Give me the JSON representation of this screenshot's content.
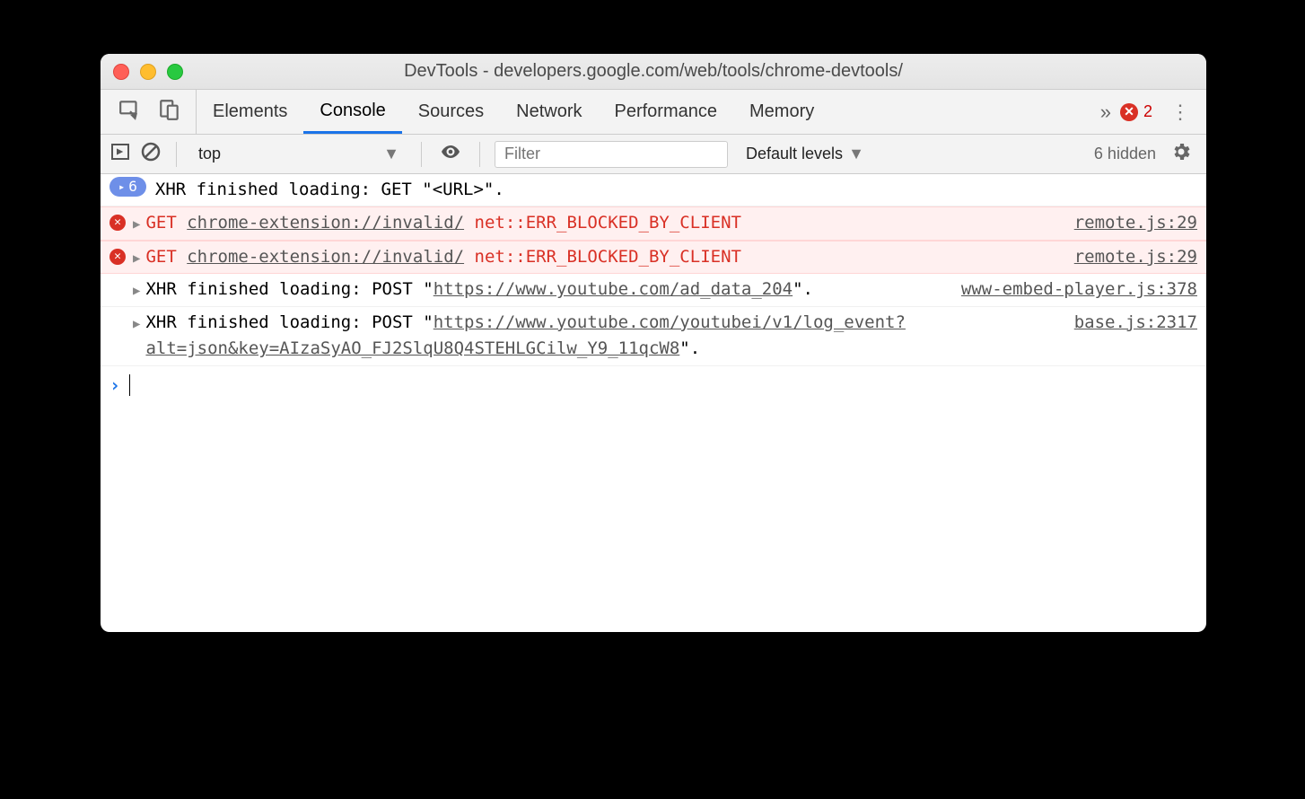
{
  "window": {
    "title": "DevTools - developers.google.com/web/tools/chrome-devtools/"
  },
  "tabs": {
    "items": [
      "Elements",
      "Console",
      "Sources",
      "Network",
      "Performance",
      "Memory"
    ],
    "active_index": 1,
    "overflow_glyph": "»",
    "error_count": "2"
  },
  "toolbar": {
    "context": "top",
    "filter_placeholder": "Filter",
    "levels_label": "Default levels",
    "hidden_text": "6 hidden"
  },
  "log": {
    "group": {
      "count": "6",
      "text": "XHR finished loading: GET \"<URL>\"."
    },
    "errors": [
      {
        "method": "GET",
        "url": "chrome-extension://invalid/",
        "err": "net::ERR_BLOCKED_BY_CLIENT",
        "source": "remote.js:29"
      },
      {
        "method": "GET",
        "url": "chrome-extension://invalid/",
        "err": "net::ERR_BLOCKED_BY_CLIENT",
        "source": "remote.js:29"
      }
    ],
    "infos": [
      {
        "prefix": "XHR finished loading: POST \"",
        "url": "https://www.youtube.com/ad_data_204",
        "suffix": "\".",
        "source": "www-embed-player.js:378"
      },
      {
        "prefix": "XHR finished loading: POST \"",
        "url": "https://www.youtube.com/youtubei/v1/log_event?alt=json&key=AIzaSyAO_FJ2SlqU8Q4STEHLGCilw_Y9_11qcW8",
        "suffix": "\".",
        "source": "base.js:2317"
      }
    ]
  }
}
